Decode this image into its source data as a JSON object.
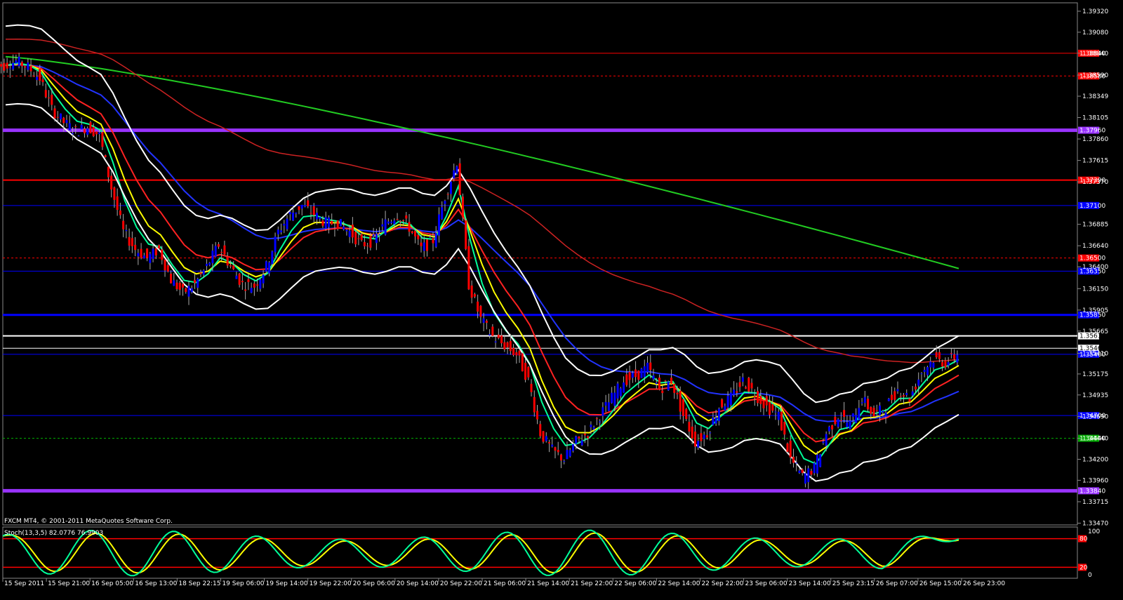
{
  "app": {
    "watermark": "FXCM MT4, © 2001-2011 MetaQuotes Software Corp."
  },
  "chart_data": {
    "type": "candlestick",
    "instrument_context": "EUR/USD style forex chart",
    "price_axis": {
      "min": 1.3345,
      "max": 1.394,
      "ticks": [
        "1.39320",
        "1.39080",
        "1.38840",
        "1.38590",
        "1.38349",
        "1.38105",
        "1.37860",
        "1.37615",
        "1.37370",
        "1.36885",
        "1.36640",
        "1.36400",
        "1.36150",
        "1.35905",
        "1.35665",
        "1.35410",
        "1.35175",
        "1.34935",
        "1.34690",
        "1.34440",
        "1.34200",
        "1.33960",
        "1.33715",
        "1.33470"
      ],
      "tick_values": [
        1.3932,
        1.3908,
        1.3884,
        1.3859,
        1.38349,
        1.38105,
        1.3786,
        1.37615,
        1.3737,
        1.36885,
        1.3664,
        1.364,
        1.3615,
        1.35905,
        1.35665,
        1.3541,
        1.35175,
        1.34935,
        1.3469,
        1.3444,
        1.342,
        1.3396,
        1.33715,
        1.3347
      ]
    },
    "time_labels": [
      "15 Sep 2011",
      "15 Sep 21:00",
      "16 Sep 05:00",
      "16 Sep 13:00",
      "18 Sep 22:15",
      "19 Sep 06:00",
      "19 Sep 14:00",
      "19 Sep 22:00",
      "20 Sep 06:00",
      "20 Sep 14:00",
      "20 Sep 22:00",
      "21 Sep 06:00",
      "21 Sep 14:00",
      "21 Sep 22:00",
      "22 Sep 06:00",
      "22 Sep 14:00",
      "22 Sep 22:00",
      "23 Sep 06:00",
      "23 Sep 14:00",
      "25 Sep 23:15",
      "26 Sep 07:00",
      "26 Sep 15:00",
      "26 Sep 23:00"
    ],
    "price_path": [
      1.387,
      1.3875,
      1.3868,
      1.3855,
      1.382,
      1.3805,
      1.3795,
      1.38,
      1.379,
      1.373,
      1.368,
      1.366,
      1.365,
      1.366,
      1.3625,
      1.361,
      1.362,
      1.364,
      1.3665,
      1.364,
      1.362,
      1.3618,
      1.364,
      1.368,
      1.37,
      1.371,
      1.37,
      1.369,
      1.369,
      1.368,
      1.3665,
      1.367,
      1.369,
      1.37,
      1.3685,
      1.366,
      1.367,
      1.372,
      1.376,
      1.362,
      1.358,
      1.356,
      1.355,
      1.354,
      1.351,
      1.345,
      1.343,
      1.342,
      1.344,
      1.345,
      1.347,
      1.349,
      1.351,
      1.3515,
      1.3525,
      1.35,
      1.351,
      1.347,
      1.344,
      1.345,
      1.348,
      1.349,
      1.351,
      1.3495,
      1.348,
      1.347,
      1.342,
      1.34,
      1.341,
      1.345,
      1.347,
      1.346,
      1.349,
      1.347,
      1.348,
      1.35,
      1.349,
      1.352,
      1.3535,
      1.353,
      1.354
    ],
    "horizontal_levels": [
      {
        "price": 1.3884,
        "label": "1.38840",
        "color": "#ff0000",
        "style": "solid",
        "width": 1
      },
      {
        "price": 1.3858,
        "label": "1.38580",
        "color": "#ff0000",
        "style": "dashed",
        "width": 1
      },
      {
        "price": 1.3796,
        "label": "1.37960",
        "color": "#9933ff",
        "style": "solid",
        "width": 5
      },
      {
        "price": 1.3739,
        "label": "1.37390",
        "color": "#ff0000",
        "style": "solid",
        "width": 2
      },
      {
        "price": 1.371,
        "label": "1.37100",
        "color": "#0000ff",
        "style": "solid",
        "width": 1
      },
      {
        "price": 1.365,
        "label": "1.36500",
        "color": "#ff0000",
        "style": "dashed",
        "width": 1
      },
      {
        "price": 1.3635,
        "label": "1.36350",
        "color": "#0000ff",
        "style": "solid",
        "width": 1
      },
      {
        "price": 1.3585,
        "label": "1.35850",
        "color": "#0000ff",
        "style": "solid",
        "width": 3
      },
      {
        "price": 1.3561,
        "label": "1.35610",
        "color": "#ffffff",
        "style": "solid",
        "width": 2
      },
      {
        "price": 1.35469,
        "label": "1.35469",
        "color": "#ffffff",
        "style": "solid",
        "width": 1
      },
      {
        "price": 1.354,
        "label": "1.35400",
        "color": "#0000ff",
        "style": "solid",
        "width": 1
      },
      {
        "price": 1.347,
        "label": "1.34700",
        "color": "#0000ff",
        "style": "solid",
        "width": 1
      },
      {
        "price": 1.3444,
        "label": "1.34440",
        "color": "#00aa00",
        "style": "dashed",
        "width": 1
      },
      {
        "price": 1.3384,
        "label": "1.33840",
        "color": "#9933ff",
        "style": "solid",
        "width": 5
      }
    ],
    "indicators": [
      {
        "name": "ma-green-long",
        "color": "#22cc22"
      },
      {
        "name": "ma-red-long",
        "color": "#cc2222"
      },
      {
        "name": "ma-blue",
        "color": "#2233ff"
      },
      {
        "name": "ma-red-short",
        "color": "#ff2222"
      },
      {
        "name": "ma-yellow",
        "color": "#ffff00"
      },
      {
        "name": "ma-green-short",
        "color": "#00ff99"
      },
      {
        "name": "bollinger",
        "color": "#ffffff"
      }
    ],
    "candle_colors": {
      "up": "#0000ff",
      "down": "#ff0000",
      "wick": "#aaaaaa"
    },
    "stochastic": {
      "label": "Stoch(13,3,5) 82.0776 76.9903",
      "main": 82.0776,
      "signal": 76.9903,
      "levels": {
        "upper": 80,
        "lower": 20
      },
      "ticks": [
        "100",
        "0"
      ],
      "level_labels": [
        "80",
        "20"
      ],
      "line_colors": {
        "main": "#00ff99",
        "signal": "#ffff00",
        "levels": "#ff0000"
      }
    }
  }
}
